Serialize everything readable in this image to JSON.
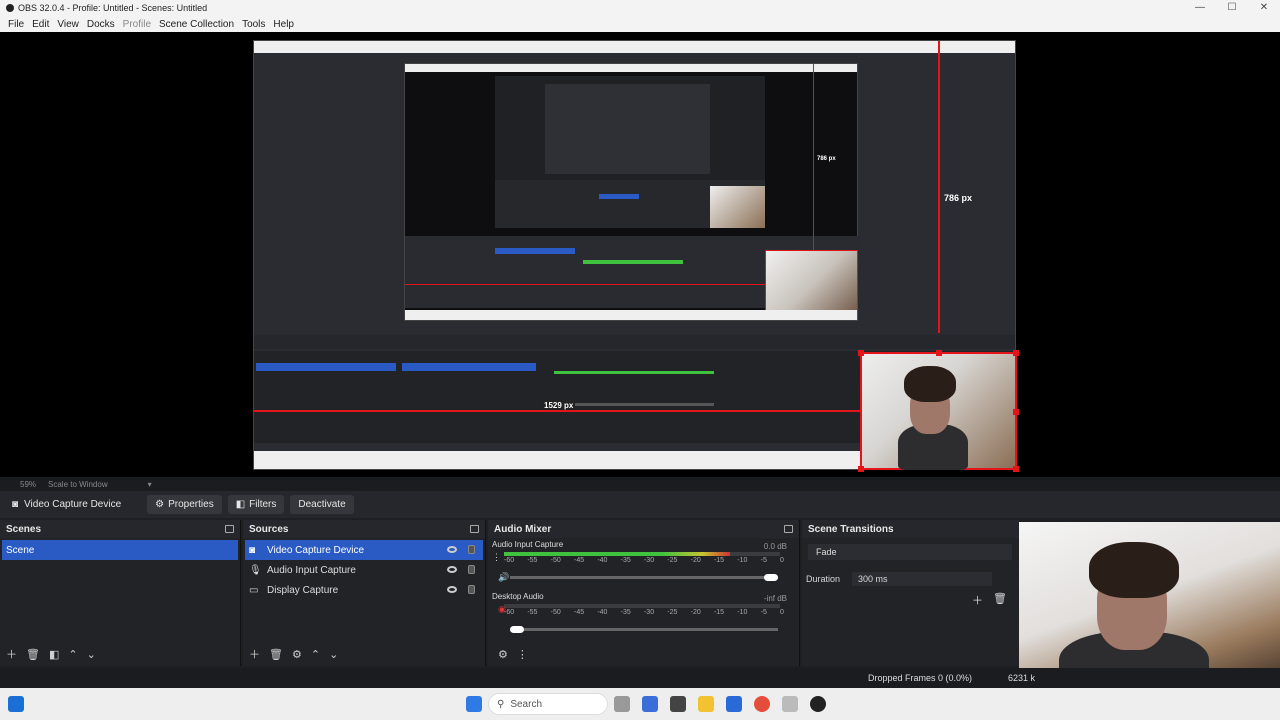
{
  "window": {
    "title": "OBS 32.0.4 - Profile: Untitled - Scenes: Untitled",
    "controls": [
      "—",
      "☐",
      "✕"
    ]
  },
  "menu": {
    "items": [
      "File",
      "Edit",
      "View",
      "Docks",
      "Profile",
      "Scene Collection",
      "Tools",
      "Help"
    ]
  },
  "preview": {
    "measure_vertical": "786 px",
    "measure_horizontal": "1529 px",
    "nested_measure": "786 px"
  },
  "zoom": {
    "level": "59%",
    "mode": "Scale to Window"
  },
  "source_toolbar": {
    "selected_source": "Video Capture Device",
    "properties": "Properties",
    "filters": "Filters",
    "deactivate": "Deactivate"
  },
  "scenes": {
    "title": "Scenes",
    "items": [
      "Scene"
    ]
  },
  "sources": {
    "title": "Sources",
    "items": [
      {
        "name": "Video Capture Device",
        "icon": "camera-icon"
      },
      {
        "name": "Audio Input Capture",
        "icon": "microphone-icon"
      },
      {
        "name": "Display Capture",
        "icon": "monitor-icon"
      }
    ]
  },
  "audio_mixer": {
    "title": "Audio Mixer",
    "ticks": [
      "-60",
      "-55",
      "-50",
      "-45",
      "-40",
      "-35",
      "-30",
      "-25",
      "-20",
      "-15",
      "-10",
      "-5",
      "0"
    ],
    "channels": [
      {
        "name": "Audio Input Capture",
        "db": "0.0 dB",
        "level": 0.82,
        "volume": 1.0
      },
      {
        "name": "Desktop Audio",
        "db": "-inf dB",
        "level": 0.0,
        "volume": 0.0
      }
    ]
  },
  "transitions": {
    "title": "Scene Transitions",
    "selected": "Fade",
    "duration_label": "Duration",
    "duration_value": "300 ms"
  },
  "status": {
    "dropped": "Dropped Frames 0 (0.0%)",
    "bitrate": "6231 k"
  },
  "taskbar": {
    "search_placeholder": "Search"
  },
  "colors": {
    "selection": "#2a5bc5",
    "accent_red": "#e3151b",
    "meter_green": "#3fc33f"
  }
}
